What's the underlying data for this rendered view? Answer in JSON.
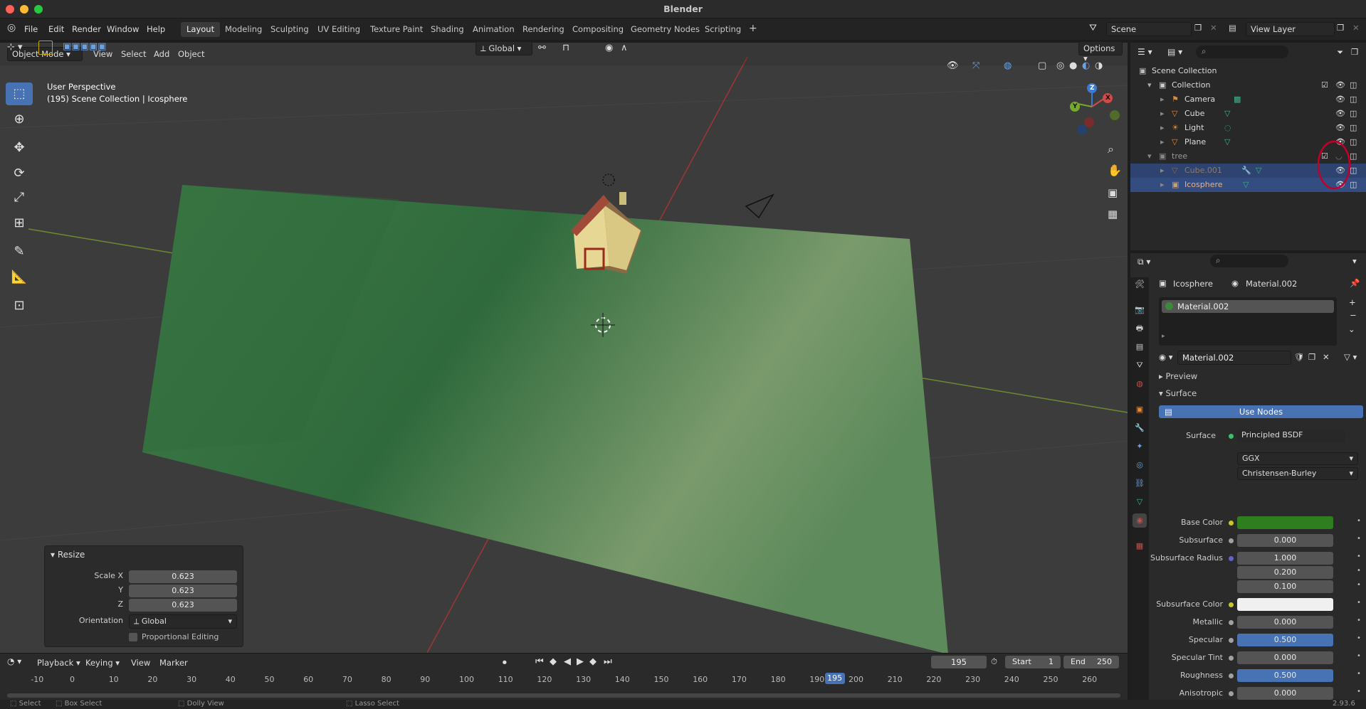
{
  "window": {
    "title": "Blender"
  },
  "menu": [
    "File",
    "Edit",
    "Render",
    "Window",
    "Help"
  ],
  "workspaces": [
    "Layout",
    "Modeling",
    "Sculpting",
    "UV Editing",
    "Texture Paint",
    "Shading",
    "Animation",
    "Rendering",
    "Compositing",
    "Geometry Nodes",
    "Scripting"
  ],
  "active_workspace": "Layout",
  "scene": {
    "scene_name": "Scene",
    "view_layer": "View Layer"
  },
  "viewport_header": {
    "mode": "Object Mode",
    "menus": [
      "View",
      "Select",
      "Add",
      "Object"
    ],
    "transform_orientation": "Global",
    "options": "Options"
  },
  "viewport": {
    "perspective": "User Perspective",
    "context": "(195) Scene Collection | Icosphere",
    "gizmo": {
      "x": "X",
      "y": "Y",
      "z": "Z"
    }
  },
  "resize_panel": {
    "title": "Resize",
    "scale_x_label": "Scale X",
    "scale_x": "0.623",
    "y_label": "Y",
    "y": "0.623",
    "z_label": "Z",
    "z": "0.623",
    "orientation_label": "Orientation",
    "orientation": "Global",
    "proportional": "Proportional Editing"
  },
  "outliner": {
    "root": "Scene Collection",
    "collection": "Collection",
    "items": [
      "Camera",
      "Cube",
      "Light",
      "Plane"
    ],
    "tree": "tree",
    "tree_items": [
      "Cube.001",
      "Icosphere"
    ]
  },
  "properties": {
    "object": "Icosphere",
    "material": "Material.002",
    "slot": "Material.002",
    "datablock": "Material.002",
    "preview": "Preview",
    "surface_section": "Surface",
    "use_nodes": "Use Nodes",
    "surface_label": "Surface",
    "surface_shader": "Principled BSDF",
    "distribution": "GGX",
    "subsurface_method": "Christensen-Burley",
    "rows": [
      {
        "label": "Base Color",
        "value": "",
        "socket": "#c7c729",
        "color": "#2e7d1f"
      },
      {
        "label": "Subsurface",
        "value": "0.000",
        "socket": "#a1a1a1"
      },
      {
        "label": "Subsurface Radius",
        "value": "1.000",
        "socket": "#6363c7"
      },
      {
        "label": "",
        "value": "0.200"
      },
      {
        "label": "",
        "value": "0.100"
      },
      {
        "label": "Subsurface Color",
        "value": "",
        "socket": "#c7c729",
        "color": "#f0f0f0"
      },
      {
        "label": "Metallic",
        "value": "0.000",
        "socket": "#a1a1a1"
      },
      {
        "label": "Specular",
        "value": "0.500",
        "socket": "#a1a1a1",
        "fill": 0.5
      },
      {
        "label": "Specular Tint",
        "value": "0.000",
        "socket": "#a1a1a1"
      },
      {
        "label": "Roughness",
        "value": "0.500",
        "socket": "#a1a1a1",
        "fill": 0.5
      },
      {
        "label": "Anisotropic",
        "value": "0.000",
        "socket": "#a1a1a1"
      }
    ]
  },
  "timeline": {
    "menus": [
      "Playback",
      "Keying",
      "View",
      "Marker"
    ],
    "current_frame": "195",
    "start_label": "Start",
    "start": "1",
    "end_label": "End",
    "end": "250",
    "ticks": [
      "-10",
      "0",
      "10",
      "20",
      "30",
      "40",
      "50",
      "60",
      "70",
      "80",
      "90",
      "100",
      "110",
      "120",
      "130",
      "140",
      "150",
      "160",
      "170",
      "180",
      "190",
      "200",
      "210",
      "220",
      "230",
      "240",
      "250",
      "260"
    ],
    "playhead": "195"
  },
  "statusbar": {
    "select": "Select",
    "box_select": "Box Select",
    "dolly": "Dolly View",
    "lasso": "Lasso Select",
    "version": "2.93.6"
  },
  "colors": {
    "accent": "#4772b3",
    "ground": "#4f8a55",
    "annotation": "#c4002a"
  }
}
